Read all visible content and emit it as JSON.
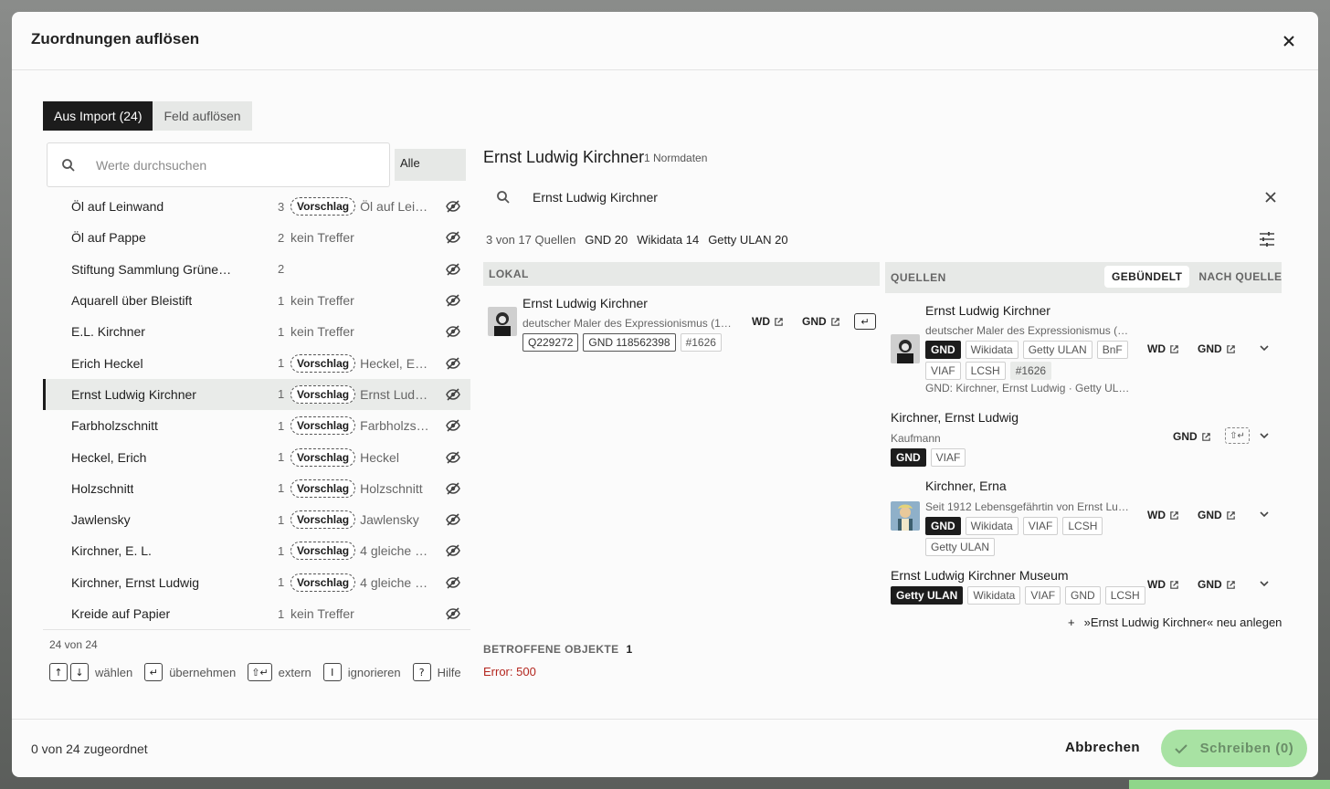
{
  "dialog": {
    "title": "Zuordnungen auflösen"
  },
  "tabs": [
    {
      "label": "Aus Import (24)"
    },
    {
      "label": "Feld auflösen"
    }
  ],
  "search": {
    "placeholder": "Werte durchsuchen",
    "filter": "Alle"
  },
  "list": {
    "rows": [
      {
        "name": "Öl auf Leinwand",
        "count": "3",
        "status": "Vorschlag",
        "match": "Öl auf Lei…"
      },
      {
        "name": "Öl auf Pappe",
        "count": "2",
        "status": "kein Treffer",
        "match": ""
      },
      {
        "name": "Stiftung Sammlung Grüne…",
        "count": "2",
        "status": "",
        "match": ""
      },
      {
        "name": "Aquarell über Bleistift",
        "count": "1",
        "status": "kein Treffer",
        "match": ""
      },
      {
        "name": "E.L. Kirchner",
        "count": "1",
        "status": "kein Treffer",
        "match": ""
      },
      {
        "name": "Erich Heckel",
        "count": "1",
        "status": "Vorschlag",
        "match": "Heckel, Er…"
      },
      {
        "name": "Ernst Ludwig Kirchner",
        "count": "1",
        "status": "Vorschlag",
        "match": "Ernst Lud…",
        "selected": true
      },
      {
        "name": "Farbholzschnitt",
        "count": "1",
        "status": "Vorschlag",
        "match": "Farbholzs…"
      },
      {
        "name": "Heckel, Erich",
        "count": "1",
        "status": "Vorschlag",
        "match": "Heckel"
      },
      {
        "name": "Holzschnitt",
        "count": "1",
        "status": "Vorschlag",
        "match": "Holzschnitt"
      },
      {
        "name": "Jawlensky",
        "count": "1",
        "status": "Vorschlag",
        "match": "Jawlensky"
      },
      {
        "name": "Kirchner, E. L.",
        "count": "1",
        "status": "Vorschlag",
        "match": "4 gleiche …"
      },
      {
        "name": "Kirchner, Ernst Ludwig",
        "count": "1",
        "status": "Vorschlag",
        "match": "4 gleiche …"
      },
      {
        "name": "Kreide auf Papier",
        "count": "1",
        "status": "kein Treffer",
        "match": ""
      }
    ],
    "count_label": "24 von 24"
  },
  "shortcuts": [
    {
      "keys": [
        "↑",
        "↓"
      ],
      "label": "wählen"
    },
    {
      "keys": [
        "↵"
      ],
      "label": "übernehmen"
    },
    {
      "keys": [
        "⇧↵"
      ],
      "label": "extern"
    },
    {
      "keys": [
        "I"
      ],
      "label": "ignorieren"
    },
    {
      "keys": [
        "?"
      ],
      "label": "Hilfe"
    }
  ],
  "detail": {
    "title": "Ernst Ludwig Kirchner",
    "subtitle": "1  Normdaten",
    "query": "Ernst Ludwig Kirchner",
    "stats": {
      "sources": "3 von 17 Quellen",
      "gnd": "GND 20",
      "wikidata": "Wikidata 14",
      "getty": "Getty ULAN 20"
    },
    "local_header": "LOKAL",
    "sources_header": "QUELLEN",
    "seg": {
      "bundled": "GEBÜNDELT",
      "by_source": "NACH QUELLE"
    },
    "local_card": {
      "title": "Ernst Ludwig Kirchner",
      "desc": "deutscher Maler des Expressionismus (1…",
      "chips": [
        "Q229272",
        "GND 118562398",
        "#1626"
      ],
      "wd": "WD",
      "gnd": "GND"
    },
    "source_cards": [
      {
        "title": "Ernst Ludwig Kirchner",
        "desc": "deutscher Maler des Expressionismus (…",
        "chips": [
          "GND",
          "Wikidata",
          "Getty ULAN",
          "BnF",
          "VIAF",
          "LCSH",
          "#1626"
        ],
        "extra": "GND: Kirchner, Ernst Ludwig · Getty ULA…",
        "wd": "WD",
        "gnd": "GND"
      },
      {
        "title": "Kirchner, Ernst Ludwig",
        "desc": "Kaufmann",
        "chips": [
          "GND",
          "VIAF"
        ],
        "gnd": "GND"
      },
      {
        "title": "Kirchner, Erna",
        "desc": "Seit 1912 Lebensgefährtin von Ernst Lu…",
        "chips": [
          "GND",
          "Wikidata",
          "VIAF",
          "LCSH",
          "Getty ULAN"
        ],
        "wd": "WD",
        "gnd": "GND"
      },
      {
        "title": "Ernst Ludwig Kirchner Museum",
        "desc": "",
        "chips": [
          "Getty ULAN",
          "Wikidata",
          "VIAF",
          "GND",
          "LCSH"
        ],
        "wd": "WD",
        "gnd": "GND"
      }
    ],
    "new_entry": "»Ernst Ludwig Kirchner« neu anlegen",
    "affected_label": "BETROFFENE OBJEKTE",
    "affected_count": "1",
    "error": "Error: 500"
  },
  "footer": {
    "assigned": "0 von 24 zugeordnet",
    "cancel": "Abbrechen",
    "write": "Schreiben (0)"
  },
  "colors": {
    "dark": "#1c1c1c",
    "accent_green": "#a8e2a3",
    "error": "#b3261e"
  }
}
